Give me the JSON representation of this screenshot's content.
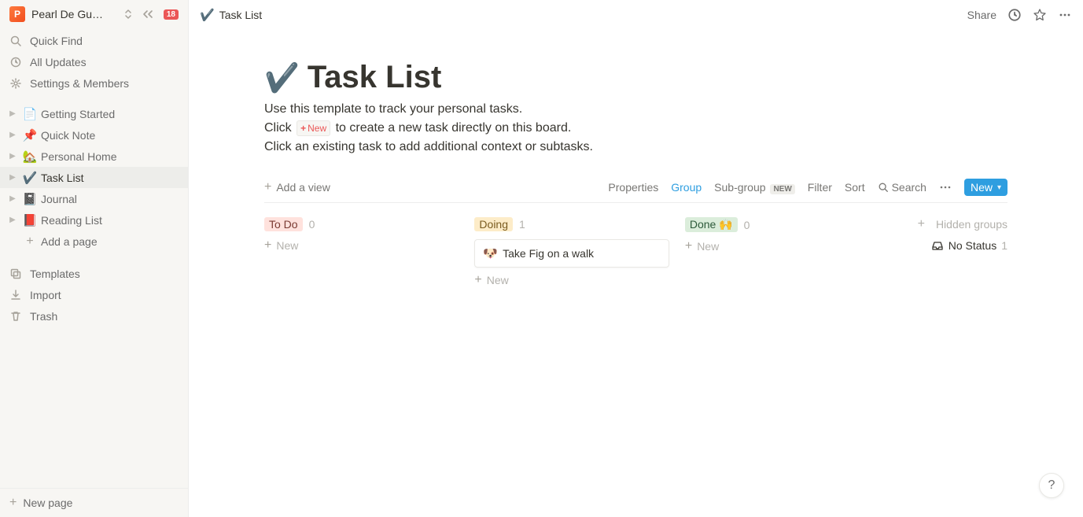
{
  "workspace": {
    "avatar_letter": "P",
    "name": "Pearl De Gu…",
    "notif_count": "18"
  },
  "sidebar": {
    "quick_find": "Quick Find",
    "all_updates": "All Updates",
    "settings": "Settings & Members",
    "add_page": "Add a page",
    "templates": "Templates",
    "import": "Import",
    "trash": "Trash",
    "new_page": "New page",
    "pages": [
      {
        "emoji": "📄",
        "label": "Getting Started"
      },
      {
        "emoji": "📌",
        "label": "Quick Note"
      },
      {
        "emoji": "🏡",
        "label": "Personal Home"
      },
      {
        "emoji": "✔️",
        "label": "Task List"
      },
      {
        "emoji": "📓",
        "label": "Journal"
      },
      {
        "emoji": "📕",
        "label": "Reading List"
      }
    ]
  },
  "topbar": {
    "crumb_emoji": "✔️",
    "crumb_title": "Task List",
    "share": "Share"
  },
  "page": {
    "emoji": "✔️",
    "title": "Task List",
    "desc_line1": "Use this template to track your personal tasks.",
    "desc_line2a": "Click ",
    "inline_new": "New",
    "desc_line2b": " to create a new task directly on this board.",
    "desc_line3": "Click an existing task to add additional context or subtasks."
  },
  "db": {
    "add_view": "Add a view",
    "properties": "Properties",
    "group": "Group",
    "sub_group": "Sub-group",
    "sub_group_badge": "NEW",
    "filter": "Filter",
    "sort": "Sort",
    "search": "Search",
    "new": "New"
  },
  "board": {
    "new_label": "New",
    "hidden_groups": "Hidden groups",
    "no_status": "No Status",
    "no_status_count": "1",
    "columns": [
      {
        "label": "To Do",
        "count": "0"
      },
      {
        "label": "Doing",
        "count": "1"
      },
      {
        "label": "Done 🙌",
        "count": "0"
      }
    ],
    "doing_card": {
      "emoji": "🐶",
      "title": "Take Fig on a walk"
    }
  },
  "help": "?"
}
